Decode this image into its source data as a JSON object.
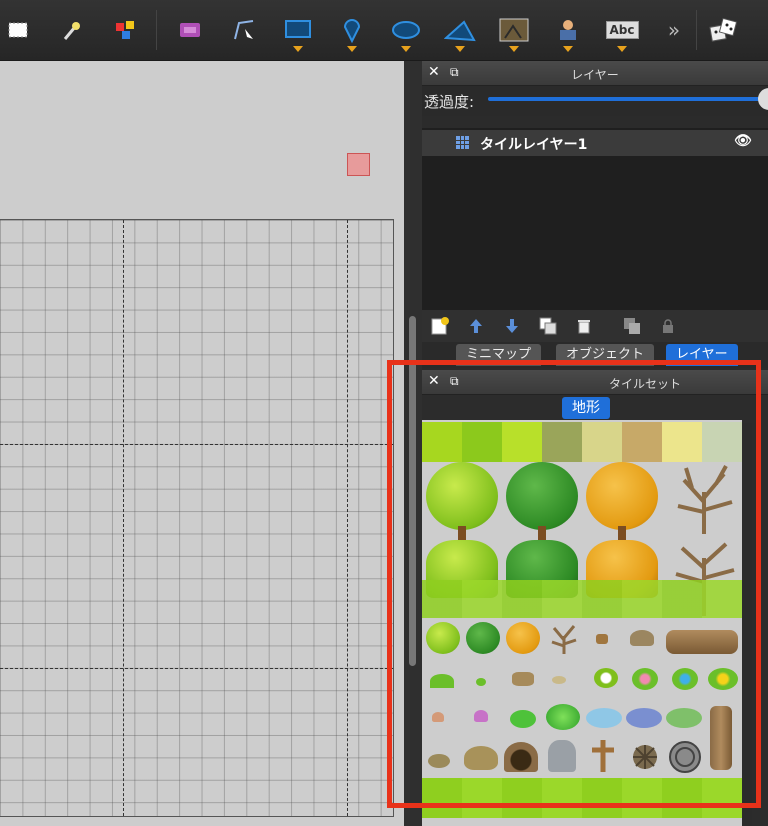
{
  "toolbar": {
    "tools": [
      {
        "icon": "rect-select-icon"
      },
      {
        "icon": "magic-wand-icon"
      },
      {
        "icon": "select-same-tile-icon"
      },
      {
        "icon": "stamp-icon"
      },
      {
        "icon": "edit-polygon-icon"
      },
      {
        "icon": "insert-rectangle-icon"
      },
      {
        "icon": "insert-point-icon"
      },
      {
        "icon": "insert-ellipse-icon"
      },
      {
        "icon": "insert-polygon-icon"
      },
      {
        "icon": "insert-image-icon"
      },
      {
        "icon": "insert-template-icon"
      },
      {
        "icon": "insert-text-icon"
      },
      {
        "icon": "more-tools-icon"
      },
      {
        "icon": "random-mode-icon"
      }
    ],
    "text_tool_label": "Abc",
    "overflow": "»"
  },
  "layers_panel": {
    "title": "レイヤー",
    "opacity_label": "透過度:",
    "opacity_value": 1.0,
    "layers": [
      {
        "name": "タイルレイヤー1",
        "visible": true
      }
    ],
    "tabs": [
      "ミニマップ",
      "オブジェクト",
      "レイヤー"
    ],
    "active_tab": "レイヤー"
  },
  "tileset_panel": {
    "title": "タイルセット",
    "tabs": [
      "地形"
    ],
    "active_tab": "地形"
  },
  "colors": {
    "accent": "#1f6fd9",
    "highlight": "#e8321a",
    "marker": "#e79b9b"
  }
}
